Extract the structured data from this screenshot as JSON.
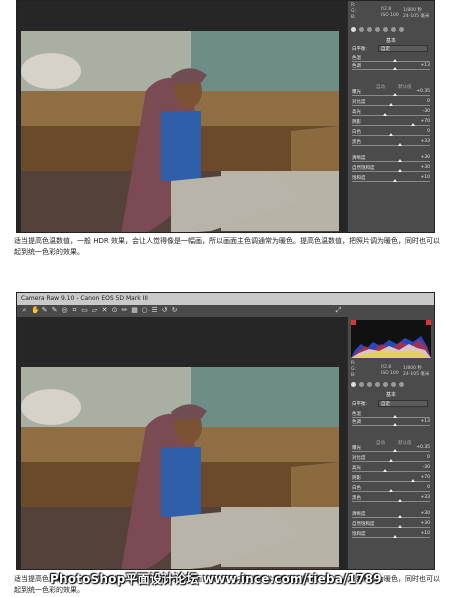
{
  "screen1": {
    "panel": {
      "readout": [
        "R:",
        "G:",
        "B:"
      ],
      "exif_left": "f/2.8",
      "exif_right": "1/800 秒",
      "exif_iso": "ISO 100",
      "exif_lens": "24-105 毫米",
      "section_title": "基本",
      "wb_label": "白平衡:",
      "wb_value": "自定",
      "auto_label": "自动",
      "default_label": "默认值",
      "sliders": [
        {
          "label": "色温",
          "value": "",
          "level": 0.55
        },
        {
          "label": "色调",
          "value": "+13",
          "level": 0.55
        },
        {
          "label": "曝光",
          "value": "+0.35",
          "level": 0.55
        },
        {
          "label": "对比度",
          "value": "0",
          "level": 0.5
        },
        {
          "label": "高光",
          "value": "-30",
          "level": 0.42
        },
        {
          "label": "阴影",
          "value": "+70",
          "level": 0.78
        },
        {
          "label": "白色",
          "value": "0",
          "level": 0.5
        },
        {
          "label": "黑色",
          "value": "+33",
          "level": 0.62
        },
        {
          "label": "清晰度",
          "value": "+30",
          "level": 0.62
        },
        {
          "label": "自然饱和度",
          "value": "+30",
          "level": 0.62
        },
        {
          "label": "饱和度",
          "value": "+10",
          "level": 0.55
        }
      ]
    },
    "caption": "适当提高色温数值，一般 HDR 效果，会让人觉得像是一幅画，所以画面主色调通常为暖色。提高色温数值，把照片调为暖色，同时也可以起到统一色彩的效果。"
  },
  "screen2": {
    "title": "Camera Raw 9.10 - Canon EOS 5D Mark III",
    "panel": {
      "readout": [
        "R:",
        "G:",
        "B:"
      ],
      "exif_left": "f/2.8",
      "exif_right": "1/800 秒",
      "exif_iso": "ISO 100",
      "exif_lens": "24-105 毫米",
      "section_title": "基本",
      "wb_label": "白平衡:",
      "wb_value": "自定",
      "auto_label": "自动",
      "default_label": "默认值",
      "sliders": [
        {
          "label": "色温",
          "value": "",
          "level": 0.55
        },
        {
          "label": "色调",
          "value": "+13",
          "level": 0.55
        },
        {
          "label": "曝光",
          "value": "+0.35",
          "level": 0.55
        },
        {
          "label": "对比度",
          "value": "0",
          "level": 0.5
        },
        {
          "label": "高光",
          "value": "-30",
          "level": 0.42
        },
        {
          "label": "阴影",
          "value": "+70",
          "level": 0.78
        },
        {
          "label": "白色",
          "value": "0",
          "level": 0.5
        },
        {
          "label": "黑色",
          "value": "+33",
          "level": 0.62
        },
        {
          "label": "清晰度",
          "value": "+30",
          "level": 0.62
        },
        {
          "label": "自然饱和度",
          "value": "+30",
          "level": 0.62
        },
        {
          "label": "饱和度",
          "value": "+10",
          "level": 0.55
        }
      ]
    },
    "caption": "适当提高色温数值，一般 HDR 效果，会让人觉得像是一幅画，所以画面主色调通常为暖色。提高色温数值，把照片调为暖色，同时也可以起到统一色彩的效果。"
  },
  "watermark": "PhotoShop平面设计论坛 www.ince.com/tieba/1789"
}
